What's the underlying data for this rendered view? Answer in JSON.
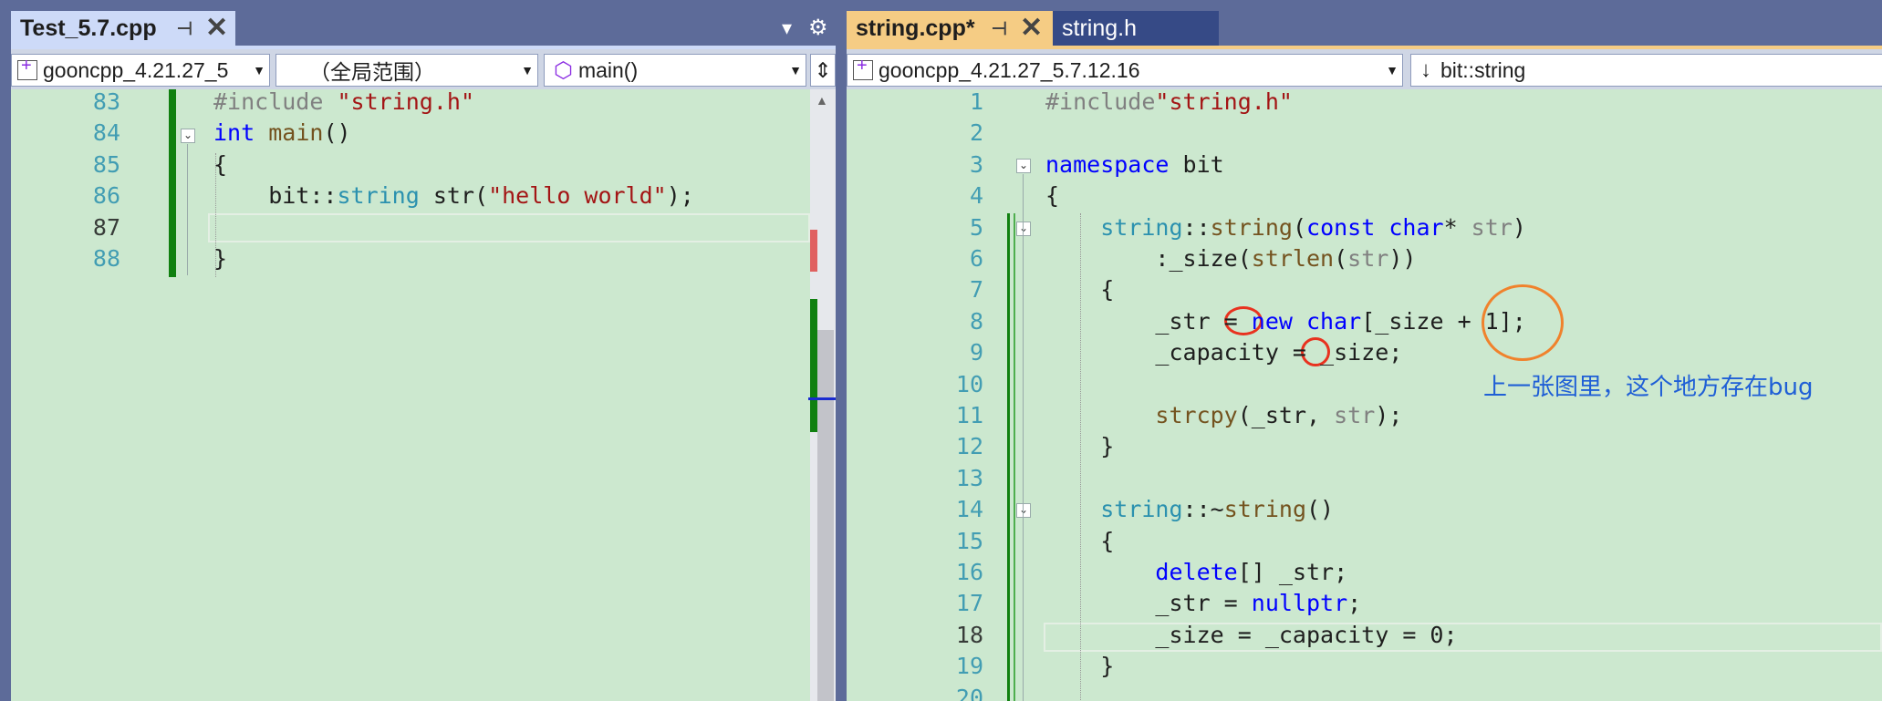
{
  "left": {
    "tab": {
      "title": "Test_5.7.cpp",
      "pin": "⊣",
      "close": "✕"
    },
    "tab_menu": {
      "dropdown": "▾",
      "gear": "⚙"
    },
    "nav": {
      "project": "gooncpp_4.21.27_5",
      "scope": "（全局范围）",
      "member": "main()",
      "split": "⇕"
    },
    "lines": [
      {
        "num": "83",
        "html": "<span class=\"pp\">#include</span> <span class=\"str\">\"string.h\"</span>"
      },
      {
        "num": "84",
        "html": "<span class=\"kw\">int</span> <span class=\"fn\">main</span>()"
      },
      {
        "num": "85",
        "html": "{"
      },
      {
        "num": "86",
        "html": "    bit::<span class=\"ty\">string</span> <span class=\"nm\">str</span>(<span class=\"str\">\"hello world\"</span>);"
      },
      {
        "num": "87",
        "html": ""
      },
      {
        "num": "88",
        "html": "}"
      }
    ]
  },
  "right": {
    "tabs": [
      {
        "title": "string.cpp*",
        "pin": "⊣",
        "close": "✕"
      },
      {
        "title": "string.h"
      }
    ],
    "nav": {
      "project": "gooncpp_4.21.27_5.7.12.16",
      "member": "bit::string"
    },
    "lines": [
      {
        "num": "1",
        "html": "<span class=\"pp\">#include</span><span class=\"str\">\"string.h\"</span>"
      },
      {
        "num": "2",
        "html": ""
      },
      {
        "num": "3",
        "html": "<span class=\"kw\">namespace</span> bit"
      },
      {
        "num": "4",
        "html": "{"
      },
      {
        "num": "5",
        "html": "    <span class=\"ty\">string</span>::<span class=\"fn\">string</span>(<span class=\"kw\">const</span> <span class=\"kw\">char</span>* <span class=\"pm\">str</span>)"
      },
      {
        "num": "6",
        "html": "        :_size(<span class=\"fn\">strlen</span>(<span class=\"pm\">str</span>))"
      },
      {
        "num": "7",
        "html": "    {"
      },
      {
        "num": "8",
        "html": "        _str = <span class=\"kw\">new</span> <span class=\"kw\">char</span>[_size + 1];"
      },
      {
        "num": "9",
        "html": "        _capacity = _size;"
      },
      {
        "num": "10",
        "html": ""
      },
      {
        "num": "11",
        "html": "        <span class=\"fn\">strcpy</span>(_str, <span class=\"pm\">str</span>);"
      },
      {
        "num": "12",
        "html": "    }"
      },
      {
        "num": "13",
        "html": ""
      },
      {
        "num": "14",
        "html": "    <span class=\"ty\">string</span>::~<span class=\"fn\">string</span>()"
      },
      {
        "num": "15",
        "html": "    {"
      },
      {
        "num": "16",
        "html": "        <span class=\"kw\">delete</span>[] _str;"
      },
      {
        "num": "17",
        "html": "        _str = <span class=\"kw\">nullptr</span>;"
      },
      {
        "num": "18",
        "html": "        _size = _capacity = 0;"
      },
      {
        "num": "19",
        "html": "    }"
      },
      {
        "num": "20",
        "html": ""
      }
    ],
    "annotation": "上一张图里，这个地方存在bug"
  }
}
